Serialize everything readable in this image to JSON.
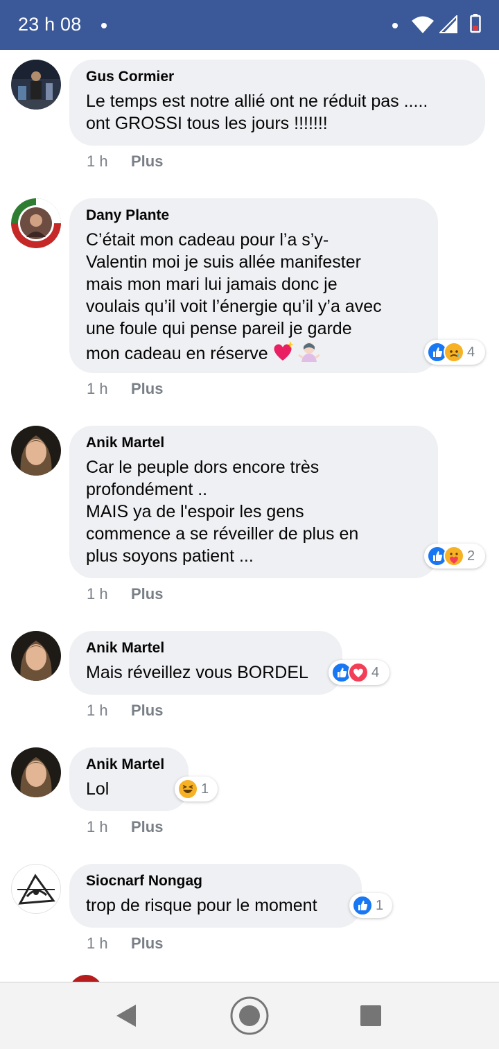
{
  "status_bar": {
    "time": "23 h 08",
    "icons": [
      "notification-dot-icon",
      "wifi-icon",
      "signal-icon",
      "battery-icon"
    ]
  },
  "comments": [
    {
      "author": "Gus Cormier",
      "text": "Le temps est notre allié ont ne réduit pas .....\nont GROSSI tous les jours !!!!!!!",
      "time": "1 h",
      "more": "Plus",
      "reactions": null
    },
    {
      "author": "Dany Plante",
      "text": "C’était mon cadeau pour l’a s’y-\nValentin moi je suis allée manifester\nmais mon mari lui jamais donc je\nvoulais qu’il voit l’énergie qu’il y’a avec\nune foule qui pense pareil je garde\nmon cadeau en réserve",
      "emojis": [
        "sparkling-heart-emoji",
        "woman-shrugging-emoji"
      ],
      "time": "1 h",
      "more": "Plus",
      "reactions": {
        "types": [
          "like",
          "sad"
        ],
        "count": "4"
      }
    },
    {
      "author": "Anik Martel",
      "text": "Car le peuple dors encore très\nprofondément ..\nMAIS ya de l'espoir les gens\ncommence a se réveiller de plus en\nplus soyons patient ...",
      "time": "1 h",
      "more": "Plus",
      "reactions": {
        "types": [
          "like",
          "care"
        ],
        "count": "2"
      }
    },
    {
      "author": "Anik Martel",
      "text": "Mais réveillez vous BORDEL",
      "time": "1 h",
      "more": "Plus",
      "reactions": {
        "types": [
          "like",
          "love"
        ],
        "count": "4"
      }
    },
    {
      "author": "Anik Martel",
      "text": "Lol",
      "time": "1 h",
      "more": "Plus",
      "reactions": {
        "types": [
          "haha"
        ],
        "count": "1"
      }
    },
    {
      "author": "Siocnarf Nongag",
      "text": "trop de risque pour le moment",
      "time": "1 h",
      "more": "Plus",
      "reactions": {
        "types": [
          "like"
        ],
        "count": "1"
      }
    }
  ],
  "nav": {
    "icons": [
      "back-icon",
      "home-icon",
      "recents-icon"
    ]
  },
  "colors": {
    "status_bar": "#3b5998",
    "bubble": "#eff0f3",
    "like": "#1877f2",
    "love": "#f33e58",
    "meta_text": "#7a7f87"
  }
}
